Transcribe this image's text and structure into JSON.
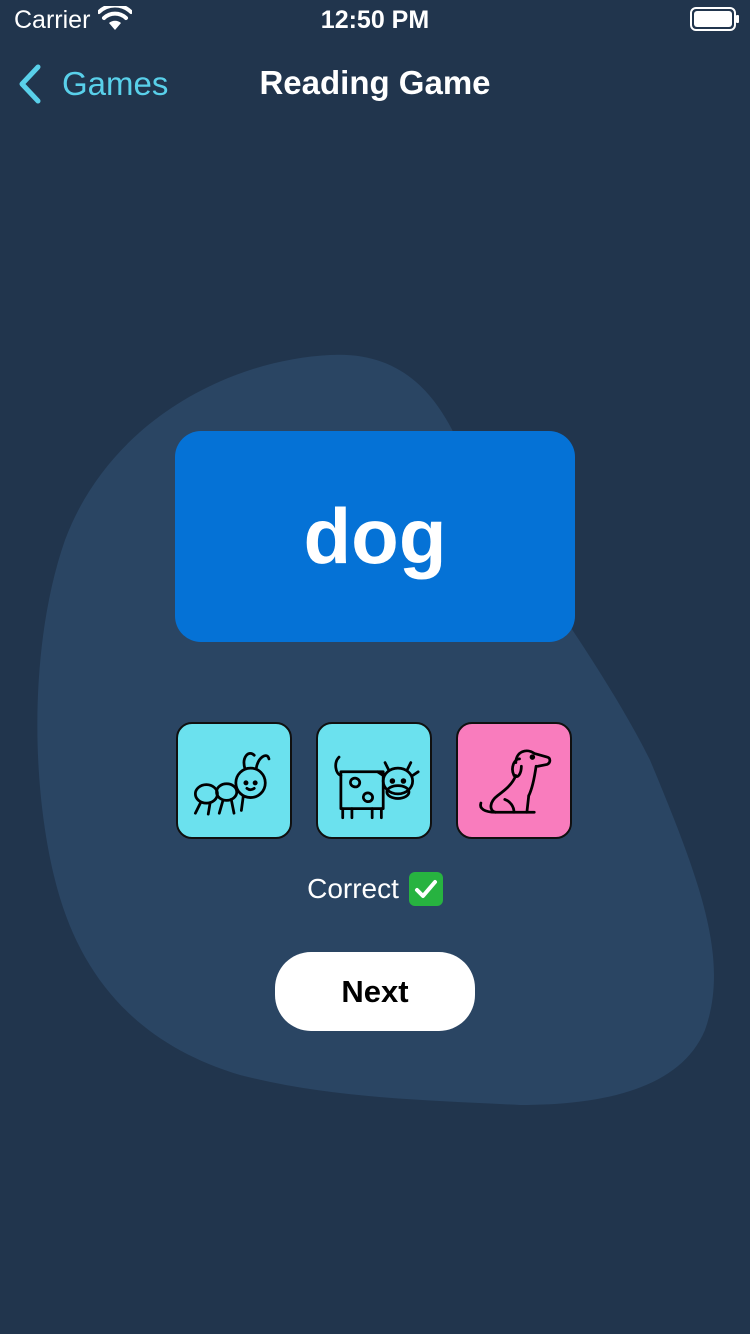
{
  "status_bar": {
    "carrier": "Carrier",
    "time": "12:50 PM",
    "icons": [
      "wifi-icon",
      "battery-icon"
    ]
  },
  "nav": {
    "back_label": "Games",
    "title": "Reading Game"
  },
  "word_card": {
    "word": "dog",
    "color": "#0572d6"
  },
  "options": [
    {
      "icon": "ant-icon",
      "state": "default",
      "color": "#6be1ee"
    },
    {
      "icon": "cow-icon",
      "state": "default",
      "color": "#6be1ee"
    },
    {
      "icon": "dog-icon",
      "state": "selected",
      "color": "#f97cbd"
    }
  ],
  "feedback": {
    "text": "Correct",
    "icon": "check-mark-icon"
  },
  "next_button": {
    "label": "Next"
  },
  "colors": {
    "background": "#21354d",
    "blob": "#2a4563",
    "accent": "#59d0ea"
  }
}
